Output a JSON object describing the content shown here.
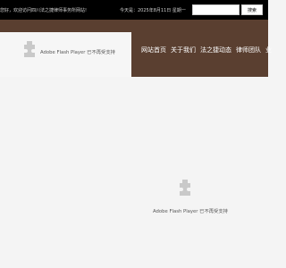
{
  "topbar": {
    "welcome_text": "您好，欢迎访问四川法之捷律师事务所网站!",
    "today_text": "今天是：2025年8月11日 星期一",
    "search": {
      "value": "",
      "button_label": "搜索"
    }
  },
  "flash_notice": "Adobe Flash Player 已不再受支持",
  "nav": {
    "items": [
      {
        "label": "网站首页"
      },
      {
        "label": "关于我们"
      },
      {
        "label": "法之捷动态"
      },
      {
        "label": "律师团队"
      },
      {
        "label": "业"
      }
    ]
  },
  "colors": {
    "topbar_bg": "#000000",
    "header_bg": "#5a3f30",
    "content_bg": "#f4f4f4"
  },
  "icons": [
    "plugin-icon"
  ]
}
